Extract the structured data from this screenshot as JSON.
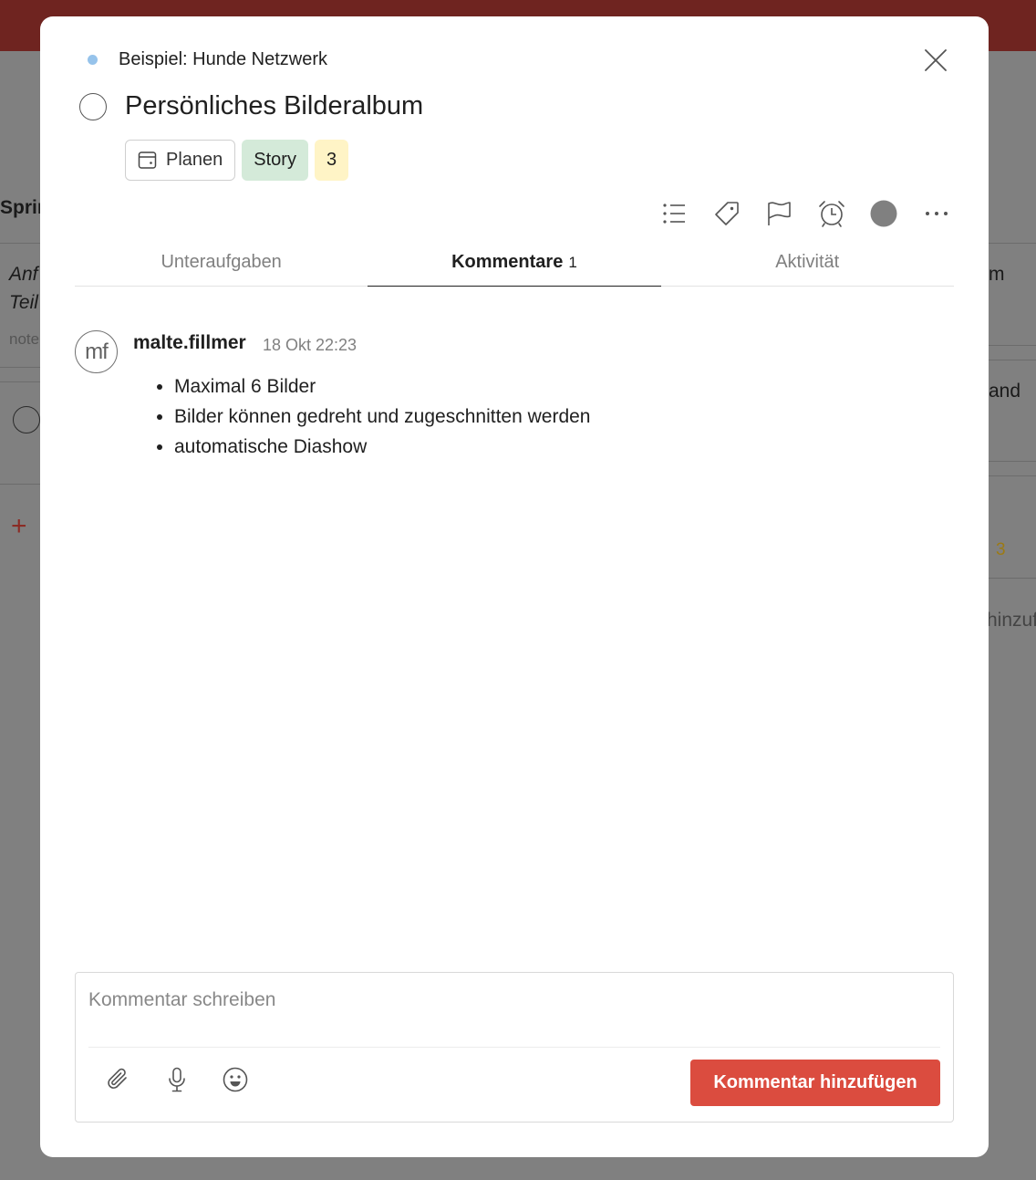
{
  "background": {
    "col_header": "Sprin",
    "task1_line1": "Anf",
    "task1_line2": "Teil",
    "task1_note": "note",
    "right_text_1": "m",
    "right_text_2": "and",
    "right_badge": "3",
    "right_text_3": "hinzuf"
  },
  "modal": {
    "project": {
      "name": "Beispiel: Hunde Netzwerk",
      "color": "#96c3eb"
    },
    "task": {
      "title": "Persönliches Bilderalbum"
    },
    "chips": {
      "plan": "Planen",
      "label": "Story",
      "points": "3"
    },
    "toolbar": [
      "list-icon",
      "tag-icon",
      "flag-icon",
      "alarm-icon",
      "color-dot-icon",
      "more-icon"
    ],
    "tabs": [
      {
        "label": "Unteraufgaben",
        "count": ""
      },
      {
        "label": "Kommentare",
        "count": "1"
      },
      {
        "label": "Aktivität",
        "count": ""
      }
    ],
    "active_tab": "Kommentare",
    "comment": {
      "avatar_initials": "mf",
      "author": "malte.fillmer",
      "time": "18 Okt 22:23",
      "items": [
        "Maximal 6 Bilder",
        "Bilder können gedreht und zugeschnitten werden",
        "automatische Diashow"
      ]
    },
    "editor": {
      "placeholder": "Kommentar schreiben",
      "value": "",
      "submit_label": "Kommentar hinzufügen"
    }
  },
  "colors": {
    "accent": "#db4c3f",
    "topbar": "#6f2420",
    "story_chip": "#d4ead9",
    "points_chip": "#fff4c6"
  }
}
